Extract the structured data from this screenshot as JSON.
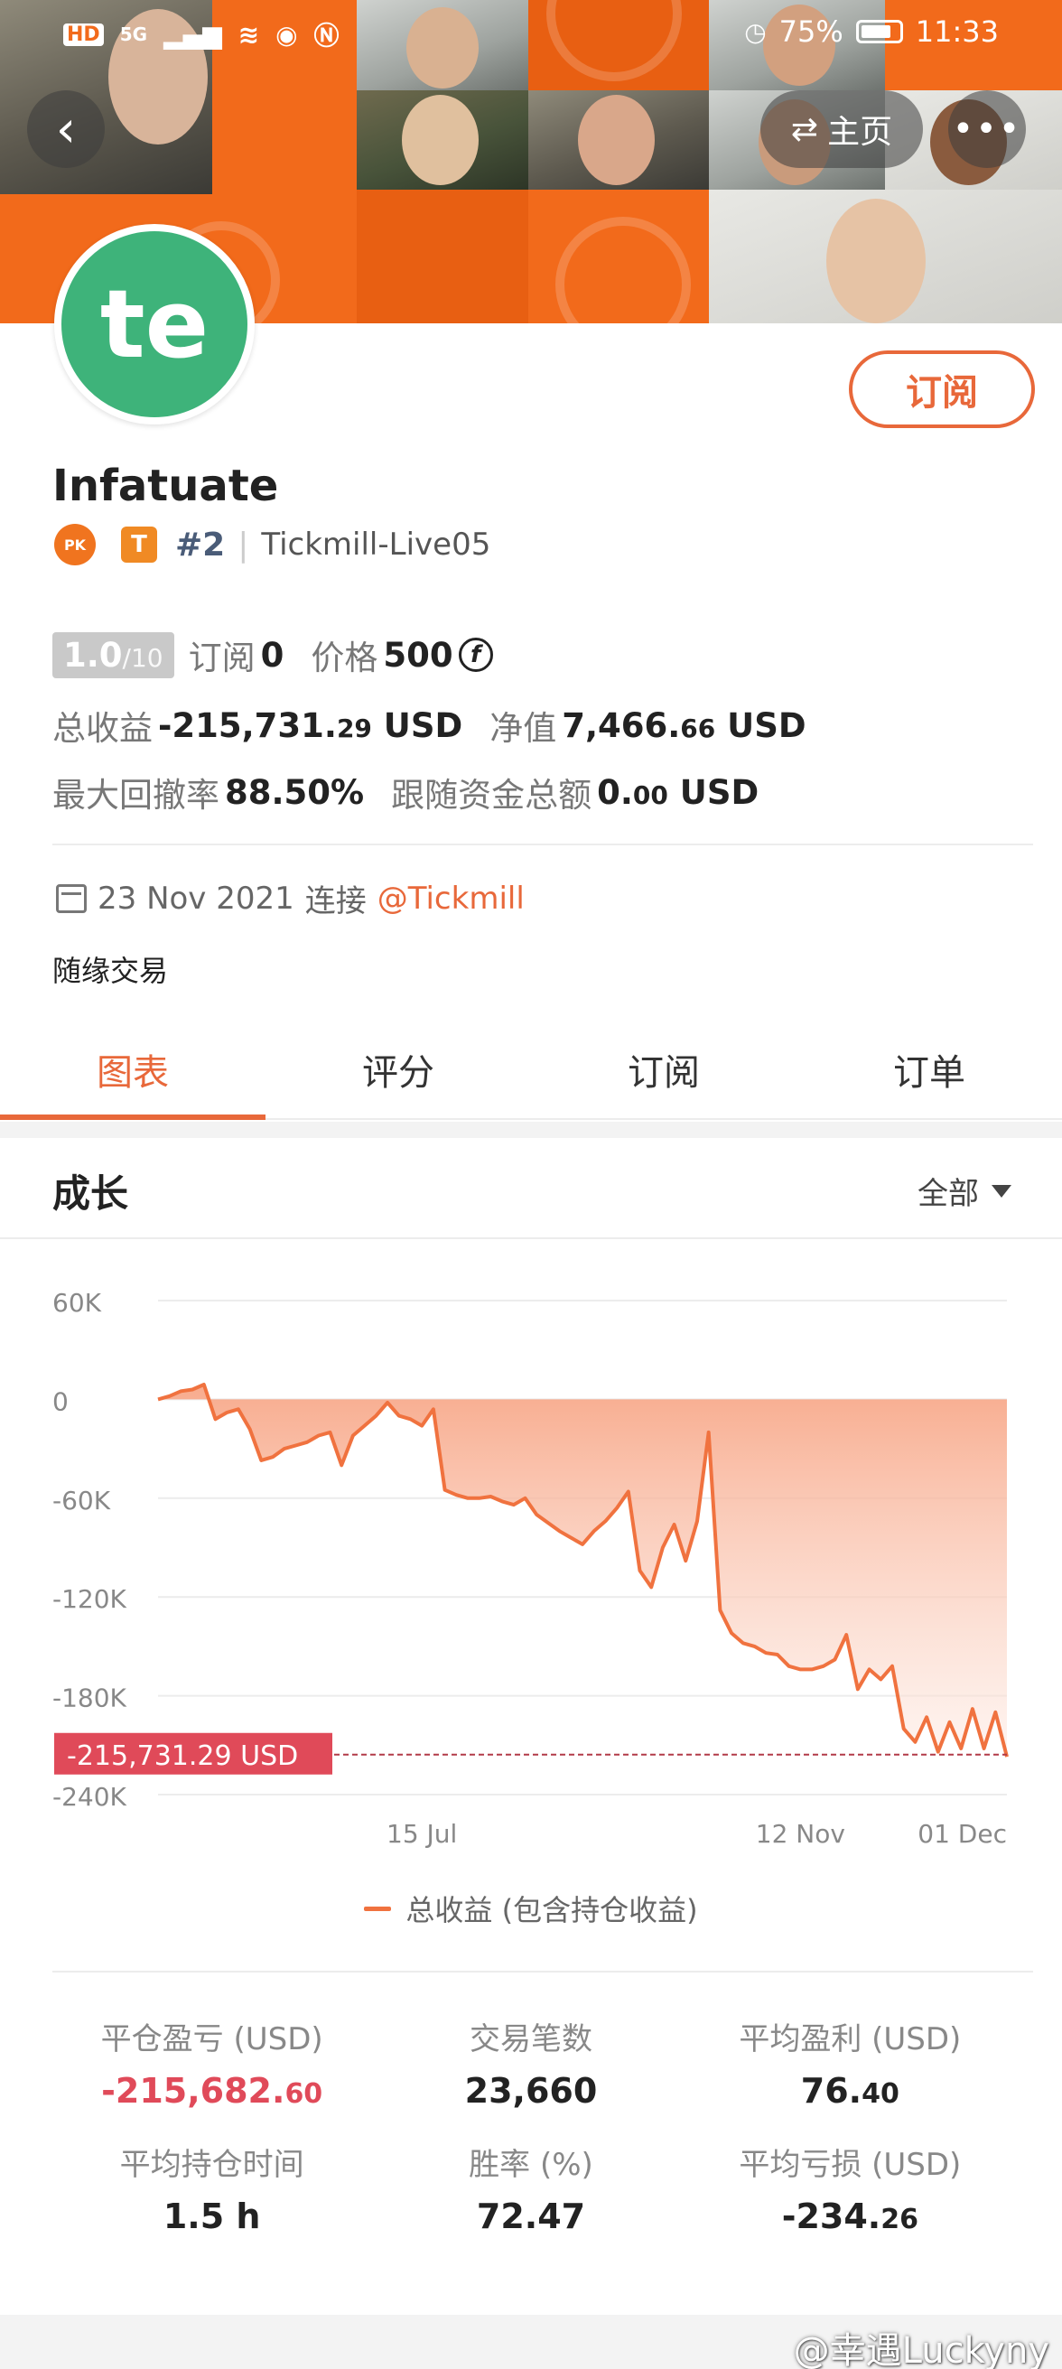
{
  "status_bar": {
    "left_icons": [
      "HD",
      "5G"
    ],
    "battery": "75%",
    "time": "11:33"
  },
  "header": {
    "back_icon": "chevron-left-icon",
    "home_label": "主页",
    "home_icon": "swap-arrows-icon",
    "more_icon": "more-dots-icon"
  },
  "profile": {
    "avatar_text": "te",
    "avatar_color": "#3eb37a",
    "subscribe_label": "订阅",
    "name": "Infatuate",
    "rank": "#2",
    "broker": "Tickmill-Live05",
    "t_badge": "T",
    "pk_badge": "PK"
  },
  "stats": {
    "score": "1.0",
    "score_max": "/10",
    "subscribe_label": "订阅",
    "subscribe_count": "0",
    "price_label": "价格",
    "price": "500",
    "coin_symbol": "f",
    "total_profit_label": "总收益",
    "total_profit_main": "-215,731.",
    "total_profit_dec": "29",
    "currency": "USD",
    "equity_label": "净值",
    "equity_main": "7,466.",
    "equity_dec": "66",
    "max_drawdown_label": "最大回撤率",
    "max_drawdown": "88.50%",
    "follow_funds_label": "跟随资金总额",
    "follow_funds_main": "0.",
    "follow_funds_dec": "00"
  },
  "connection": {
    "date": "23 Nov 2021",
    "connect_label": "连接",
    "broker_link": "@Tickmill"
  },
  "bio": "随缘交易",
  "tabs": [
    {
      "label": "图表",
      "active": true
    },
    {
      "label": "评分",
      "active": false
    },
    {
      "label": "订阅",
      "active": false
    },
    {
      "label": "订单",
      "active": false
    }
  ],
  "section": {
    "title": "成长",
    "range_label": "全部"
  },
  "chart_data": {
    "type": "area",
    "y_ticks": [
      "60K",
      "0",
      "-60K",
      "-120K",
      "-180K",
      "-240K"
    ],
    "ylim": [
      -240000,
      60000
    ],
    "x_ticks": [
      "15 Jul",
      "12 Nov",
      "01 Dec"
    ],
    "current_value_label": "-215,731.29 USD",
    "current_value": -215731.29,
    "series": [
      {
        "name": "总收益 (包含持仓收益)",
        "color": "#f0723f",
        "values": [
          0,
          2000,
          5000,
          6000,
          9000,
          -12000,
          -8000,
          -6000,
          -18000,
          -37000,
          -35000,
          -30000,
          -28000,
          -26000,
          -22000,
          -20000,
          -40000,
          -22000,
          -16000,
          -10000,
          -2000,
          -10000,
          -12000,
          -16000,
          -6000,
          -55000,
          -58000,
          -60000,
          -60000,
          -59000,
          -62000,
          -64000,
          -60000,
          -70000,
          -75000,
          -80000,
          -84000,
          -88000,
          -80000,
          -74000,
          -66000,
          -56000,
          -104000,
          -114000,
          -90000,
          -76000,
          -98000,
          -74000,
          -20000,
          -128000,
          -142000,
          -148000,
          -150000,
          -154000,
          -155000,
          -162000,
          -164000,
          -164000,
          -162000,
          -158000,
          -143000,
          -176000,
          -164000,
          -170000,
          -162000,
          -200000,
          -208000,
          -193000,
          -214000,
          -196000,
          -212000,
          -188000,
          -212000,
          -190000,
          -217000
        ]
      }
    ],
    "legend": "总收益 (包含持仓收益)"
  },
  "summary": [
    {
      "label": "平仓盈亏 (USD)",
      "value_main": "-215,682.",
      "value_dec": "60",
      "negative": true
    },
    {
      "label": "交易笔数",
      "value_main": "23,660",
      "value_dec": "",
      "negative": false
    },
    {
      "label": "平均盈利 (USD)",
      "value_main": "76.",
      "value_dec": "40",
      "negative": false
    },
    {
      "label": "平均持仓时间",
      "value_main": "1.5 h",
      "value_dec": "",
      "negative": false
    },
    {
      "label": "胜率 (%)",
      "value_main": "72.47",
      "value_dec": "",
      "negative": false
    },
    {
      "label": "平均亏损 (USD)",
      "value_main": "-234.",
      "value_dec": "26",
      "negative": false
    }
  ],
  "watermark": "@幸遇Luckyny",
  "colors": {
    "accent": "#e8683a",
    "negative": "#e04a59",
    "banner_orange": "#f26a1b"
  }
}
